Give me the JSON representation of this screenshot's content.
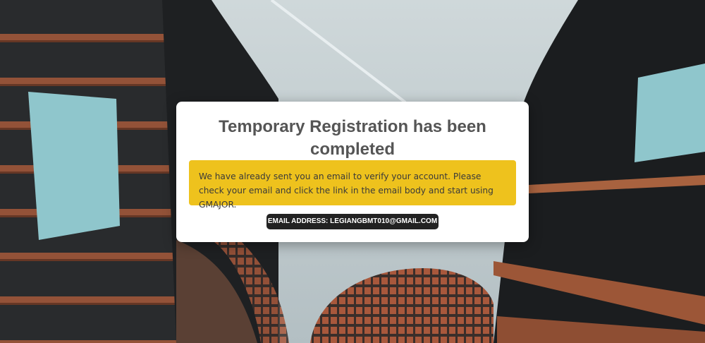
{
  "dialog": {
    "title": "Temporary Registration has been completed",
    "message": "We have already sent you an email to verify your account. Please check your email and click the link in the email body and start using GMAJOR.",
    "email_badge": "EMAIL ADDRESS: LEGIANGBMT010@GMAIL.COM"
  },
  "colors": {
    "notice_background": "#eec21d",
    "badge_background": "#222222",
    "title_text": "#555555"
  }
}
